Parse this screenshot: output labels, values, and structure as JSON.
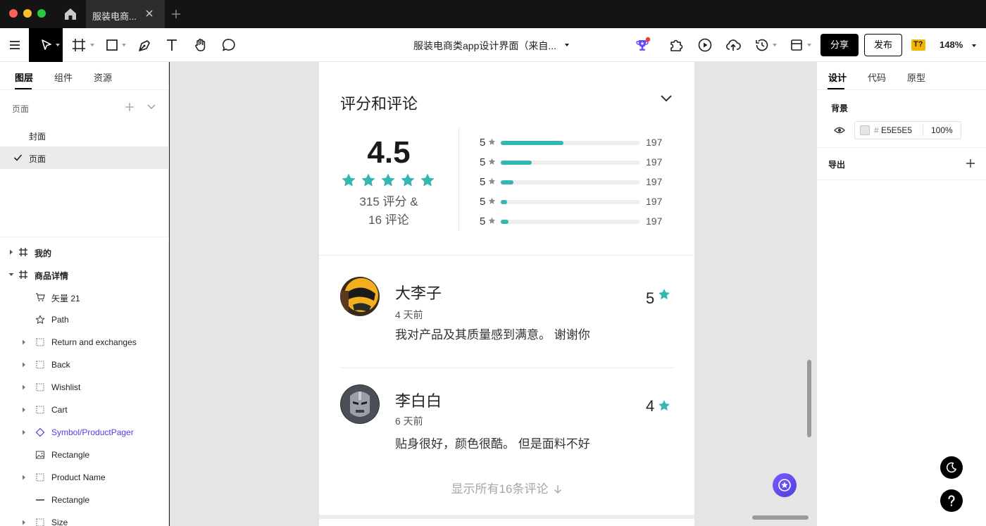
{
  "titlebar": {
    "tab_label": "服装电商...",
    "icons": [
      "home-icon",
      "close-icon",
      "plus-icon"
    ]
  },
  "toolbar": {
    "file_title": "服装电商类app设计界面（来自...",
    "share_label": "分享",
    "publish_label": "发布",
    "font_badge": "T?",
    "zoom": "148%",
    "badge_color": "#f5b400",
    "accent": "#4b3fe0"
  },
  "left_panel": {
    "tabs": [
      "图层",
      "组件",
      "资源"
    ],
    "pages_header": "页面",
    "pages": [
      {
        "label": "封面",
        "selected": false
      },
      {
        "label": "页面",
        "selected": true
      }
    ],
    "layers": [
      {
        "label": "我的",
        "icon": "frame-icon",
        "bold": true
      },
      {
        "label": "商品详情",
        "icon": "frame-icon",
        "bold": true
      },
      {
        "label": "矢量 21",
        "icon": "cart-icon"
      },
      {
        "label": "Path",
        "icon": "star-outline-icon"
      },
      {
        "label": "Return and exchanges",
        "icon": "group-icon"
      },
      {
        "label": "Back",
        "icon": "group-icon"
      },
      {
        "label": "Wishlist",
        "icon": "group-icon"
      },
      {
        "label": "Cart",
        "icon": "group-icon"
      },
      {
        "label": "Symbol/ProductPager",
        "icon": "symbol-icon",
        "symbol": true
      },
      {
        "label": "Rectangle",
        "icon": "image-icon"
      },
      {
        "label": "Product Name",
        "icon": "group-icon"
      },
      {
        "label": "Rectangle",
        "icon": "line-icon"
      },
      {
        "label": "Size",
        "icon": "group-icon"
      }
    ]
  },
  "canvas": {
    "background": "#e5e5e5",
    "rating_section": {
      "title": "评分和评论",
      "average": "4.5",
      "summary_line1": "315 评分 &",
      "summary_line2": "16 评论",
      "star_color": "#35b6b4",
      "bars": [
        {
          "label": "5",
          "count": "197",
          "fill_fraction": 0.45
        },
        {
          "label": "5",
          "count": "197",
          "fill_fraction": 0.22
        },
        {
          "label": "5",
          "count": "197",
          "fill_fraction": 0.09
        },
        {
          "label": "5",
          "count": "197",
          "fill_fraction": 0.045
        },
        {
          "label": "5",
          "count": "197",
          "fill_fraction": 0.055
        }
      ]
    },
    "reviews": [
      {
        "name": "大李子",
        "time": "4 天前",
        "text": "我对产品及其质量感到满意。 谢谢你",
        "score": "5"
      },
      {
        "name": "李白白",
        "time": "6 天前",
        "text": "贴身很好，颜色很酷。 但是面料不好",
        "score": "4"
      }
    ],
    "show_all": "显示所有16条评论"
  },
  "right_panel": {
    "tabs": [
      "设计",
      "代码",
      "原型"
    ],
    "background_title": "背景",
    "background_hash": "#",
    "background_hex": "E5E5E5",
    "background_opacity": "100%",
    "export_title": "导出"
  }
}
